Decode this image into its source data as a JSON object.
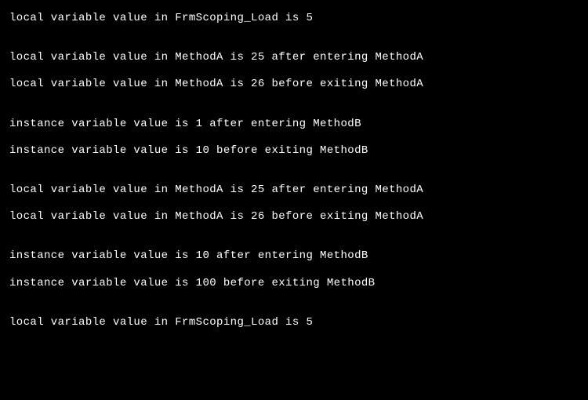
{
  "lines": [
    "local variable value in FrmScoping_Load is 5",
    "",
    "",
    "local variable value in MethodA is 25 after entering MethodA",
    "",
    "local variable value in MethodA is 26 before exiting MethodA",
    "",
    "",
    "instance variable value is 1 after entering MethodB",
    "",
    "instance variable value is 10 before exiting MethodB",
    "",
    "",
    "local variable value in MethodA is 25 after entering MethodA",
    "",
    "local variable value in MethodA is 26 before exiting MethodA",
    "",
    "",
    "instance variable value is 10 after entering MethodB",
    "",
    "instance variable value is 100 before exiting MethodB",
    "",
    "",
    "local variable value in FrmScoping_Load is 5"
  ]
}
